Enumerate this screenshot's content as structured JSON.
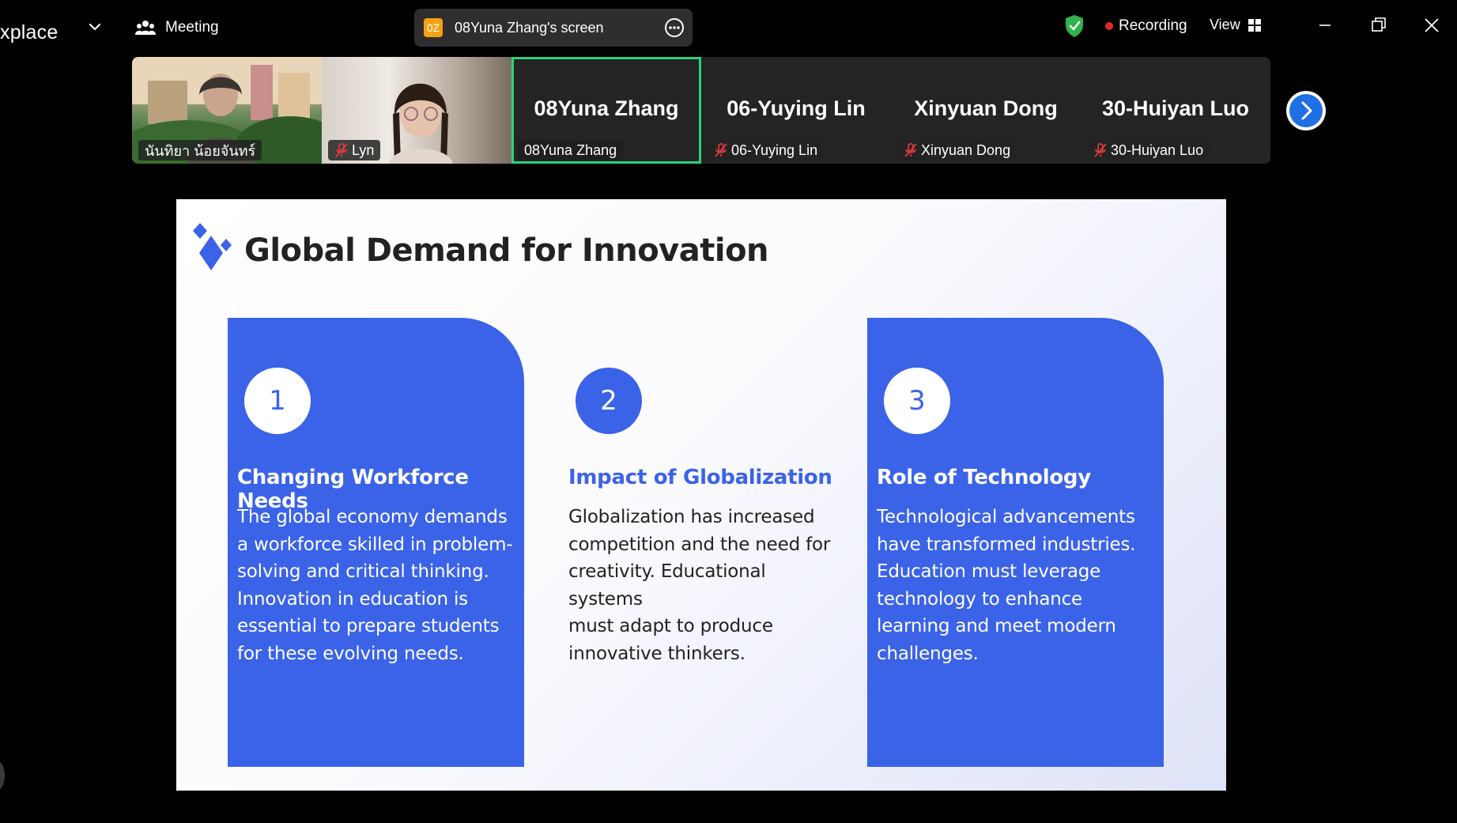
{
  "topbar": {
    "app_name": "xplace",
    "meeting_label": "Meeting",
    "share": {
      "avatar_text": "0Z",
      "label": "08Yuna Zhang's screen"
    },
    "recording_label": "Recording",
    "view_label": "View",
    "colors": {
      "security": "#2fb34a",
      "recording_dot": "#e02828",
      "share_avatar": "#f2a313"
    }
  },
  "participants": [
    {
      "tile_label": "",
      "name_tag": "นันทิยา น้อยจันทร์",
      "muted": false,
      "video": true
    },
    {
      "tile_label": "",
      "name_tag": "Lyn",
      "muted": true,
      "video": true
    },
    {
      "tile_label": "08Yuna Zhang",
      "name_tag": "08Yuna Zhang",
      "muted": false,
      "video": false,
      "active_speaker": true
    },
    {
      "tile_label": "06-Yuying Lin",
      "name_tag": "06-Yuying Lin",
      "muted": true,
      "video": false
    },
    {
      "tile_label": "Xinyuan Dong",
      "name_tag": "Xinyuan Dong",
      "muted": true,
      "video": false
    },
    {
      "tile_label": "30-Huiyan Luo",
      "name_tag": "30-Huiyan Luo",
      "muted": true,
      "video": false
    }
  ],
  "slide": {
    "title": "Global Demand for Innovation",
    "accent_color": "#3b63e8",
    "cards": [
      {
        "number": "1",
        "title": "Changing Workforce Needs",
        "lines": [
          "The global economy demands",
          "a workforce skilled in problem-",
          "solving and critical thinking.",
          "Innovation in education is",
          "essential to prepare students",
          "for these evolving needs."
        ]
      },
      {
        "number": "2",
        "title": "Impact of Globalization",
        "lines": [
          "Globalization has increased",
          "competition and the need for",
          "creativity. Educational systems",
          "must adapt to produce",
          "innovative thinkers."
        ]
      },
      {
        "number": "3",
        "title": "Role of Technology",
        "lines": [
          "Technological advancements",
          "have transformed industries.",
          "Education must leverage",
          "technology to enhance",
          "learning and meet modern",
          "challenges."
        ]
      }
    ]
  }
}
